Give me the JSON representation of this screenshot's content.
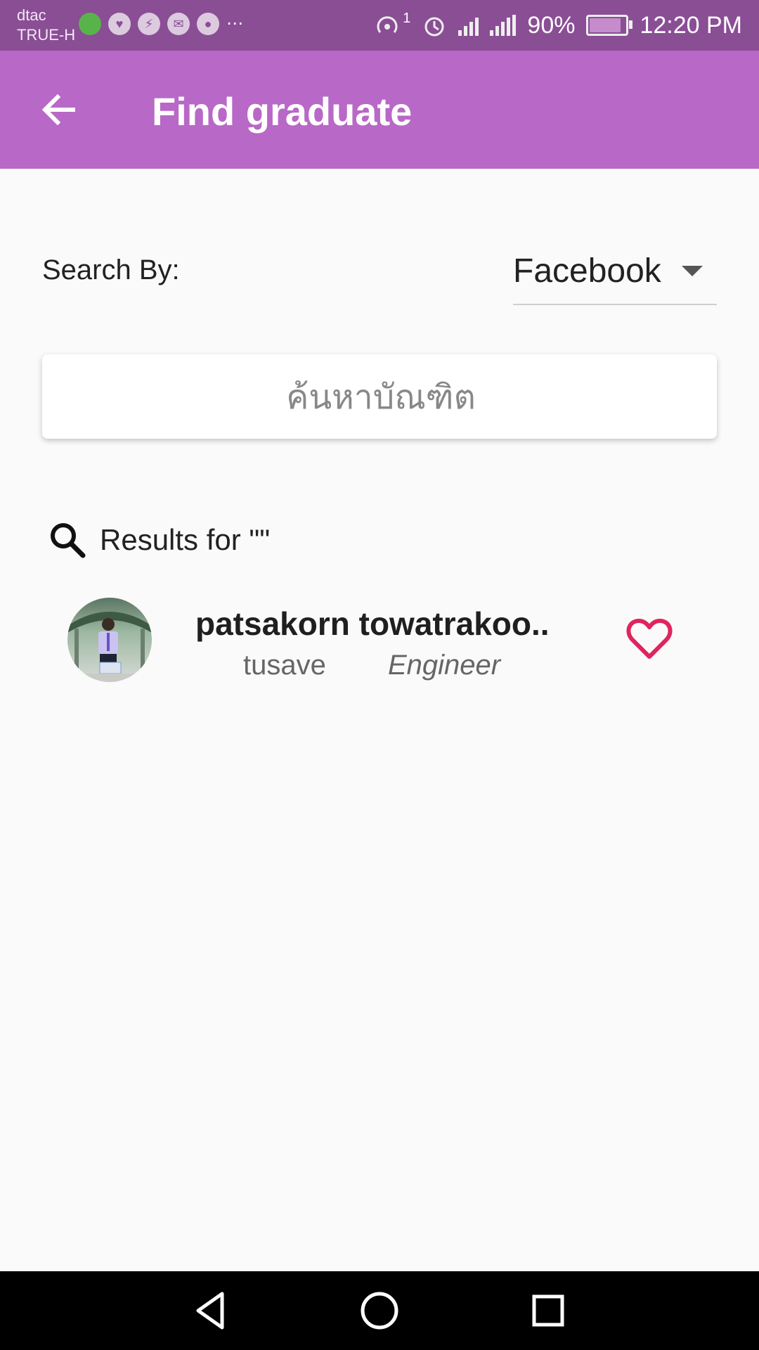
{
  "status_bar": {
    "carrier_1": "dtac",
    "carrier_2": "TRUE-H",
    "notification_icons": [
      "globe-icon",
      "heart-pulse-icon",
      "messenger-icon",
      "gmail-icon",
      "chat-icon",
      "more-icon"
    ],
    "hotspot_count": "1",
    "battery": "90%",
    "battery_level": 0.9,
    "time": "12:20 PM"
  },
  "app_bar": {
    "title": "Find graduate",
    "background_color": "#b868c6"
  },
  "search": {
    "by_label": "Search By:",
    "by_value": "Facebook",
    "placeholder": "ค้นหาบัณฑิต"
  },
  "results": {
    "heading": "Results for \"\"",
    "items": [
      {
        "name": "patsakorn towatrakoo..",
        "username": "tusave",
        "job": "Engineer",
        "favorite": false
      }
    ]
  },
  "colors": {
    "accent": "#b868c6",
    "status_bar": "#8a4e95",
    "favorite": "#e0245e"
  }
}
